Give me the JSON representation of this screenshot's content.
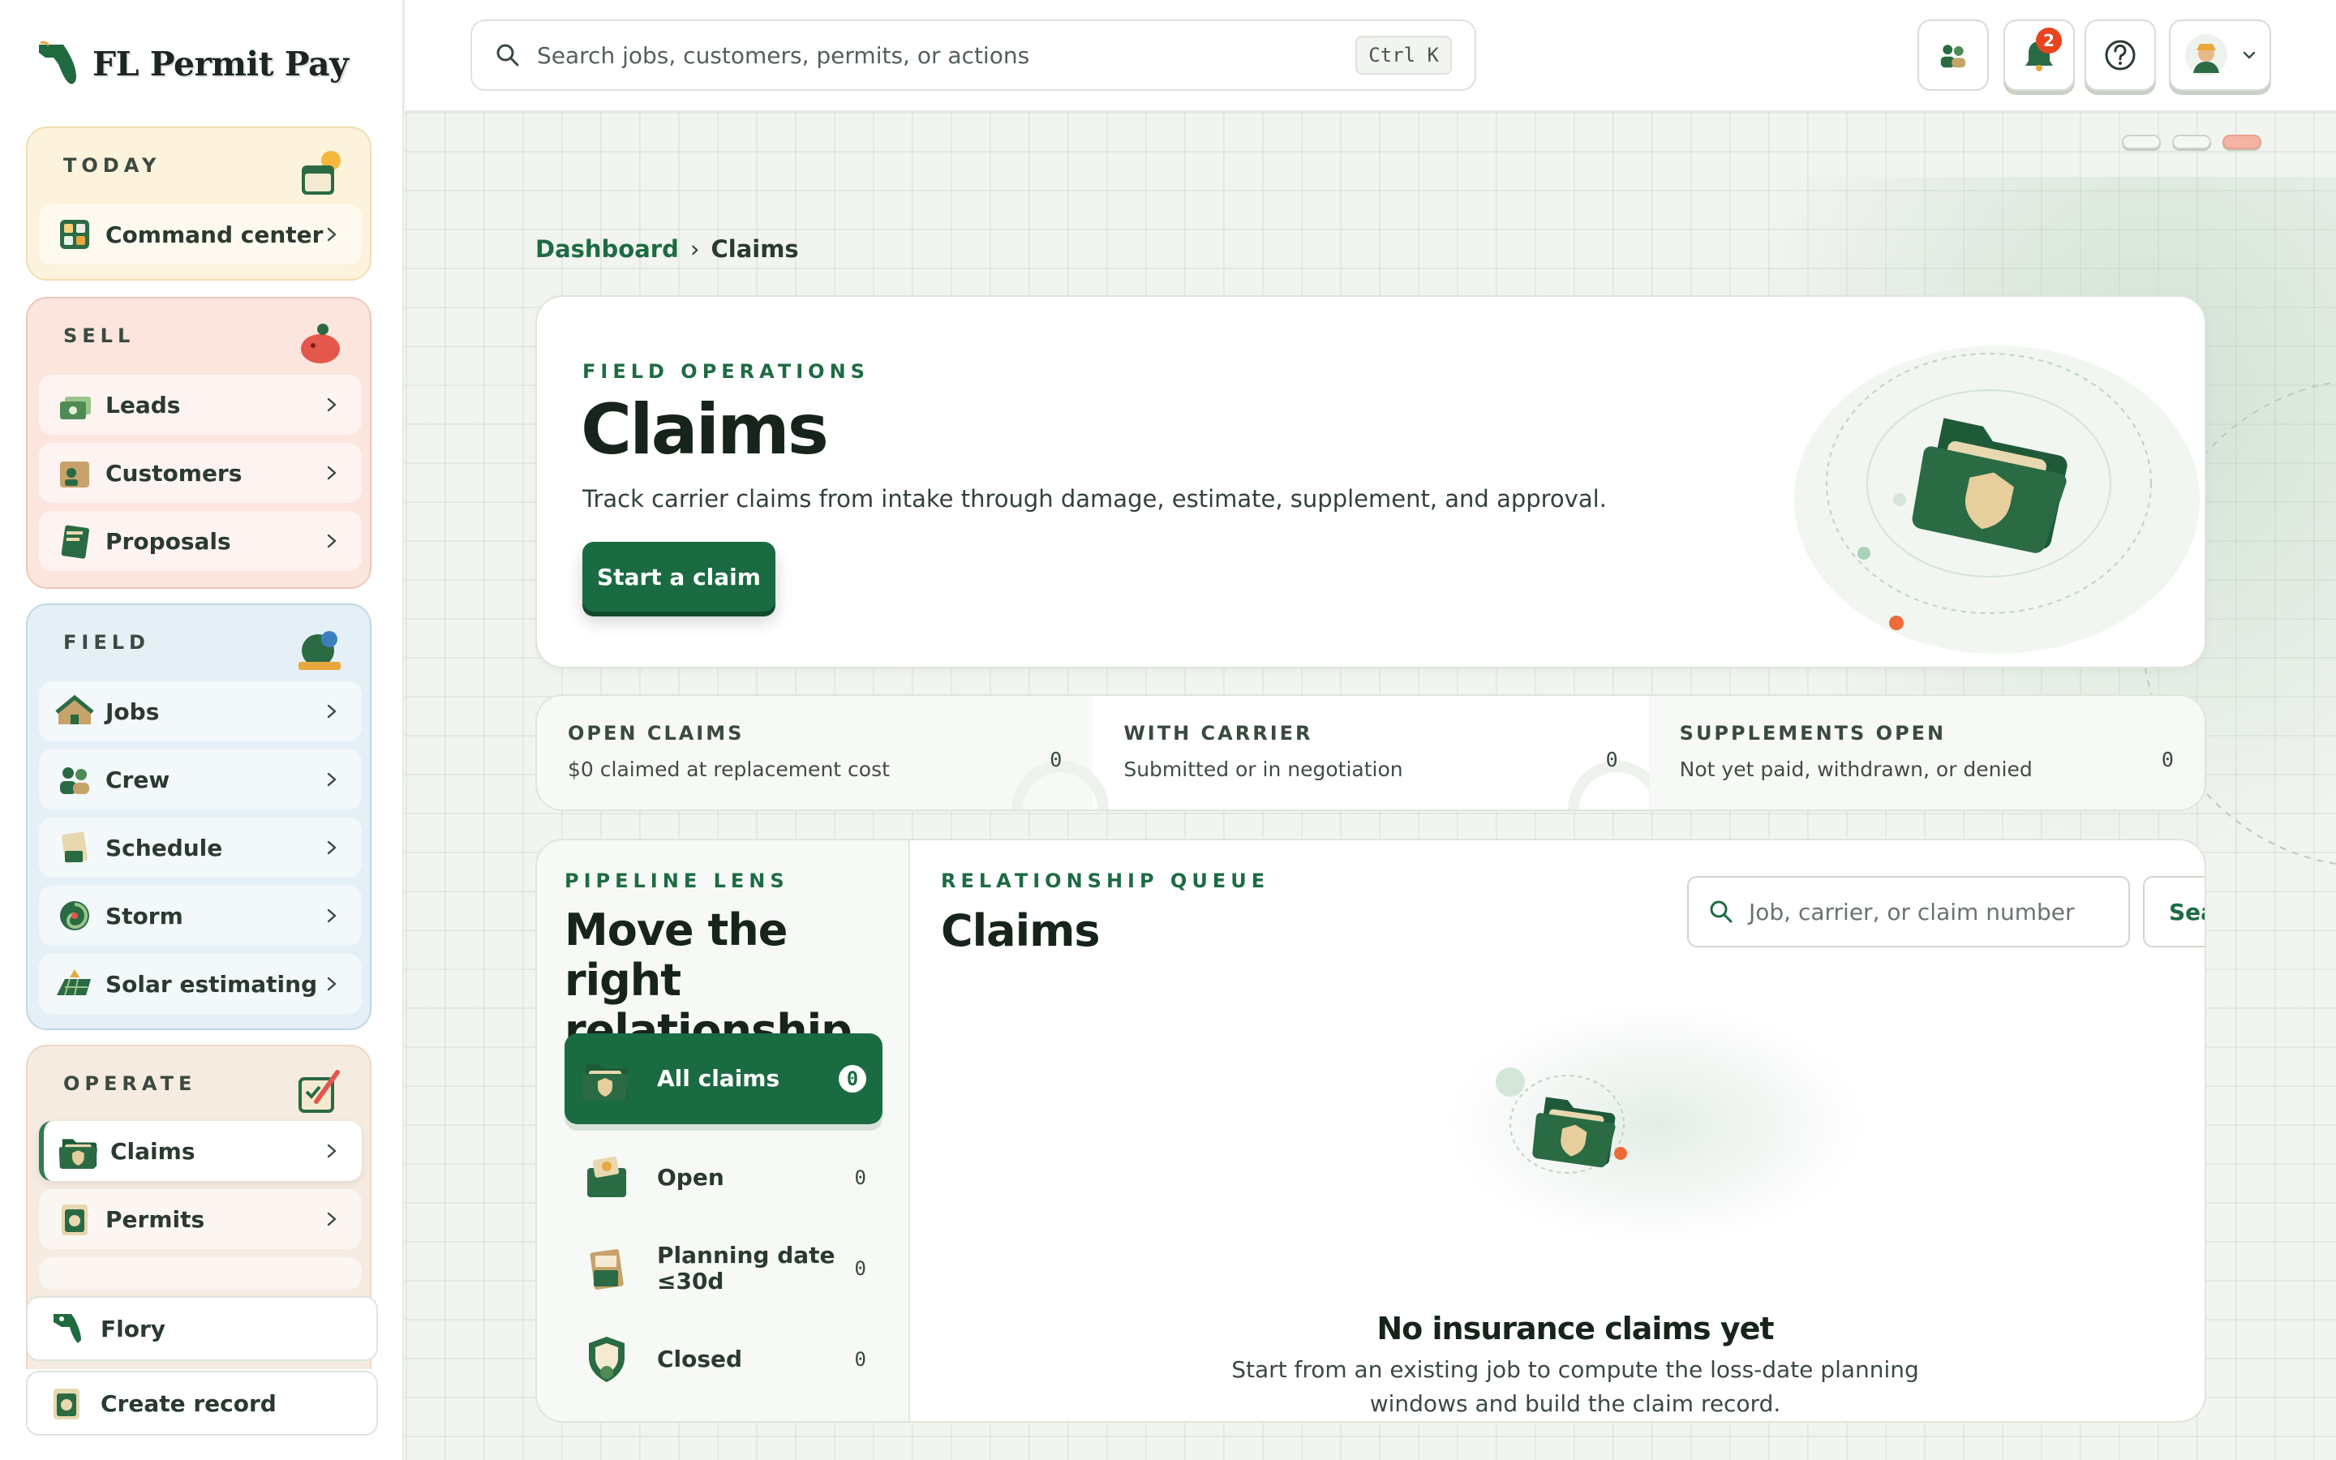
{
  "app": {
    "brand": "FL Permit Pay"
  },
  "sidebar": {
    "sections": [
      {
        "title": "TODAY",
        "items": [
          {
            "label": "Command center"
          }
        ]
      },
      {
        "title": "SELL",
        "items": [
          {
            "label": "Leads"
          },
          {
            "label": "Customers"
          },
          {
            "label": "Proposals"
          }
        ]
      },
      {
        "title": "FIELD",
        "items": [
          {
            "label": "Jobs"
          },
          {
            "label": "Crew"
          },
          {
            "label": "Schedule"
          },
          {
            "label": "Storm"
          },
          {
            "label": "Solar estimating"
          }
        ]
      },
      {
        "title": "OPERATE",
        "items": [
          {
            "label": "Claims",
            "active": true
          },
          {
            "label": "Permits"
          }
        ]
      }
    ],
    "bottom": [
      {
        "label": "Flory"
      },
      {
        "label": "Create record"
      }
    ]
  },
  "topbar": {
    "search_placeholder": "Search jobs, customers, permits, or actions",
    "shortcut": "Ctrl K",
    "notifications": "2"
  },
  "breadcrumb": {
    "parent": "Dashboard",
    "separator": "›",
    "current": "Claims"
  },
  "hero": {
    "eyebrow": "FIELD OPERATIONS",
    "title": "Claims",
    "description": "Track carrier claims from intake through damage, estimate, supplement, and approval.",
    "cta": "Start a claim"
  },
  "stats": [
    {
      "title": "OPEN CLAIMS",
      "desc": "$0 claimed at replacement cost",
      "value": "0"
    },
    {
      "title": "WITH CARRIER",
      "desc": "Submitted or in negotiation",
      "value": "0"
    },
    {
      "title": "SUPPLEMENTS OPEN",
      "desc": "Not yet paid, withdrawn, or denied",
      "value": "0"
    }
  ],
  "lens": {
    "eyebrow": "PIPELINE LENS",
    "title": "Move the right relationship.",
    "filters": [
      {
        "label": "All claims",
        "count": "0",
        "active": true
      },
      {
        "label": "Open",
        "count": "0"
      },
      {
        "label": "Planning date ≤30d",
        "count": "0"
      },
      {
        "label": "Closed",
        "count": "0"
      }
    ]
  },
  "queue": {
    "eyebrow": "RELATIONSHIP QUEUE",
    "title": "Claims",
    "search_placeholder": "Job, carrier, or claim number",
    "search_button": "Search",
    "empty_title": "No insurance claims yet",
    "empty_desc": "Start from an existing job to compute the loss-date planning windows and build the claim record."
  },
  "colors": {
    "accent": "#1b6b42",
    "badge": "#e8441d"
  }
}
